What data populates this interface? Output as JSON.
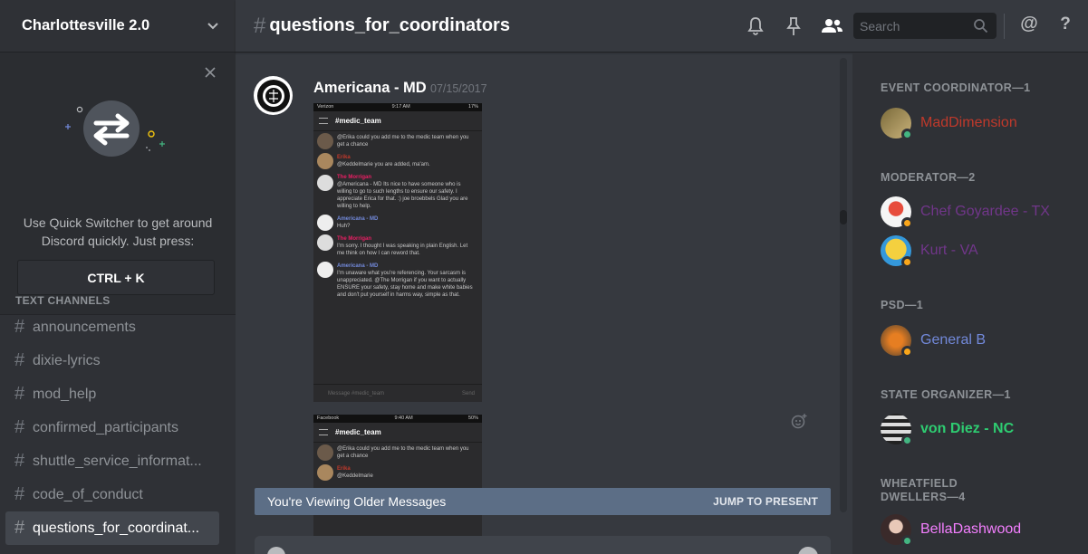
{
  "guild": {
    "name": "Charlottesville 2.0"
  },
  "quick_switcher": {
    "text_line1": "Use Quick Switcher to get around",
    "text_line2": "Discord quickly. Just press:",
    "shortcut": "CTRL + K"
  },
  "sidebar": {
    "section_title": "TEXT CHANNELS",
    "channels": [
      {
        "label": "announcements",
        "active": false
      },
      {
        "label": "dixie-lyrics",
        "active": false
      },
      {
        "label": "mod_help",
        "active": false
      },
      {
        "label": "confirmed_participants",
        "active": false
      },
      {
        "label": "shuttle_service_informat...",
        "active": false
      },
      {
        "label": "code_of_conduct",
        "active": false
      },
      {
        "label": "questions_for_coordinat...",
        "active": true
      }
    ]
  },
  "header": {
    "hash": "#",
    "channel_title": "questions_for_coordinators",
    "search_placeholder": "Search",
    "icons": [
      "bell-icon",
      "pin-icon",
      "members-icon",
      "search-icon",
      "mention-icon",
      "help-icon"
    ],
    "mention_glyph": "@",
    "help_glyph": "?"
  },
  "message": {
    "author": "Americana - MD",
    "timestamp": "07/15/2017"
  },
  "attachment1": {
    "carrier": "Verizon",
    "time": "9:17 AM",
    "battery": "17%",
    "channel": "#medic_team",
    "messages": [
      {
        "name": "",
        "text": "@Erika could you add me to the medic team when you get a chance"
      },
      {
        "name": "Erika",
        "text": "@Keddelmarie you are added, ma'am."
      },
      {
        "name": "The Morrigan",
        "text": "@Americana - MD Its nice to have someone who is willing to go to such lengths to ensure our safety. I appreciate Erica for that. :) joe broebbels Glad you are willing to help."
      },
      {
        "name": "Americana - MD",
        "text": "Huh?"
      },
      {
        "name": "The Morrigan",
        "text": "I'm sorry. I thought I was speaking in plain English. Let me think on how I can reword that."
      },
      {
        "name": "Americana - MD",
        "text": "I'm unaware what you're referencing. Your sarcasm is unappreciated. @The Morrigan if you want to actually ENSURE your safety, stay home and make white babies and don't put yourself in harms way, simple as that."
      }
    ],
    "input_placeholder": "Message #medic_team",
    "send_label": "Send"
  },
  "attachment2": {
    "carrier": "Facebook",
    "time": "9:40 AM",
    "battery": "50%",
    "channel": "#medic_team",
    "messages": [
      {
        "name": "",
        "text": "@Erika could you add me to the medic team when you get a chance"
      },
      {
        "name": "Erika",
        "text": "@Keddelmarie"
      }
    ]
  },
  "older_messages": {
    "text": "You're Viewing Older Messages",
    "jump_label": "JUMP TO PRESENT"
  },
  "members": {
    "roles": [
      {
        "title": "EVENT COORDINATOR—1",
        "members": [
          {
            "name": "MadDimension",
            "color": "#c0392b",
            "status": "#43b581"
          }
        ]
      },
      {
        "title": "MODERATOR—2",
        "members": [
          {
            "name": "Chef Goyardee - TX",
            "color": "#71368a",
            "status": "#faa61a"
          },
          {
            "name": "Kurt - VA",
            "color": "#71368a",
            "status": "#faa61a"
          }
        ]
      },
      {
        "title": "PSD—1",
        "members": [
          {
            "name": "General B",
            "color": "#7289da",
            "status": "#faa61a"
          }
        ]
      },
      {
        "title": "STATE ORGANIZER—1",
        "members": [
          {
            "name": "von Diez - NC",
            "color": "#2ecc71",
            "status": "#43b581"
          }
        ]
      },
      {
        "title": "WHEATFIELD DWELLERS—4",
        "members": [
          {
            "name": "BellaDashwood",
            "color": "#f47fff",
            "status": "#43b581"
          }
        ]
      }
    ]
  }
}
